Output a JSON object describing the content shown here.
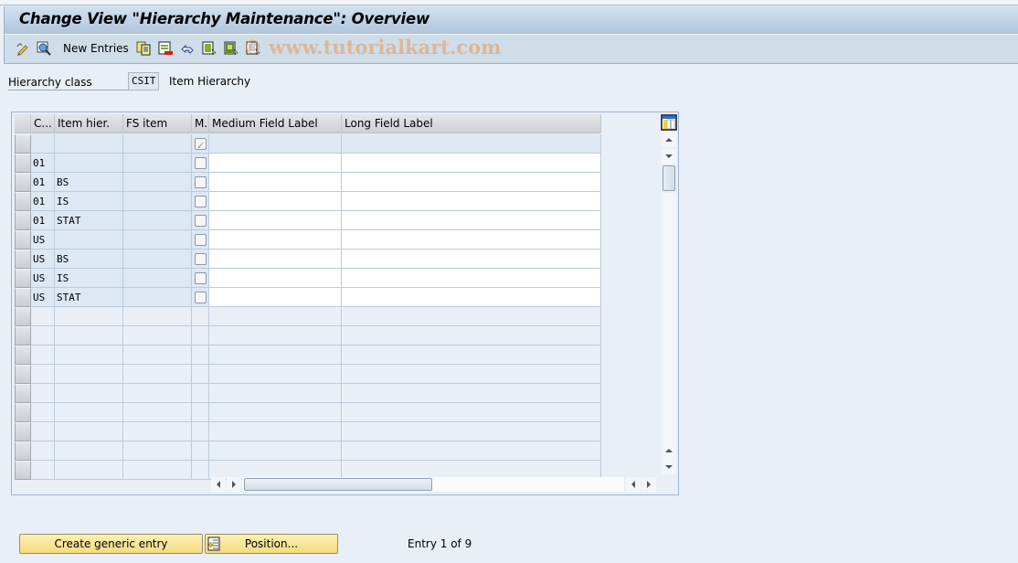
{
  "window": {
    "title": "Change View \"Hierarchy Maintenance\": Overview"
  },
  "toolbar": {
    "icons": [
      "edit-pencil-icon",
      "display-glasses-icon",
      "copy-icon",
      "delete-icon",
      "undo-icon",
      "select-all-icon",
      "select-block-icon",
      "deselect-all-icon"
    ],
    "new_entries_label": "New Entries",
    "watermark": "© www.tutorialkart.com"
  },
  "header_field": {
    "label": "Hierarchy class",
    "value": "CSIT",
    "description": "Item Hierarchy"
  },
  "table": {
    "columns": [
      "C...",
      "Item hier.",
      "FS item",
      "M.",
      "Medium Field Label",
      "Long Field Label"
    ],
    "rows": [
      {
        "c": "",
        "item_hier": "",
        "fs_item": "",
        "m_checked": true,
        "medium": "",
        "long": "",
        "type": "key"
      },
      {
        "c": "01",
        "item_hier": "",
        "fs_item": "",
        "m_checked": false,
        "medium": "",
        "long": "",
        "type": "edit"
      },
      {
        "c": "01",
        "item_hier": "BS",
        "fs_item": "",
        "m_checked": false,
        "medium": "",
        "long": "",
        "type": "edit"
      },
      {
        "c": "01",
        "item_hier": "IS",
        "fs_item": "",
        "m_checked": false,
        "medium": "",
        "long": "",
        "type": "edit"
      },
      {
        "c": "01",
        "item_hier": "STAT",
        "fs_item": "",
        "m_checked": false,
        "medium": "",
        "long": "",
        "type": "edit"
      },
      {
        "c": "US",
        "item_hier": "",
        "fs_item": "",
        "m_checked": false,
        "medium": "",
        "long": "",
        "type": "edit"
      },
      {
        "c": "US",
        "item_hier": "BS",
        "fs_item": "",
        "m_checked": false,
        "medium": "",
        "long": "",
        "type": "edit"
      },
      {
        "c": "US",
        "item_hier": "IS",
        "fs_item": "",
        "m_checked": false,
        "medium": "",
        "long": "",
        "type": "edit"
      },
      {
        "c": "US",
        "item_hier": "STAT",
        "fs_item": "",
        "m_checked": false,
        "medium": "",
        "long": "",
        "type": "edit"
      }
    ],
    "empty_rows": 9
  },
  "footer": {
    "create_generic_label": "Create generic entry",
    "position_label": "Position...",
    "entry_info": "Entry 1 of 9"
  }
}
